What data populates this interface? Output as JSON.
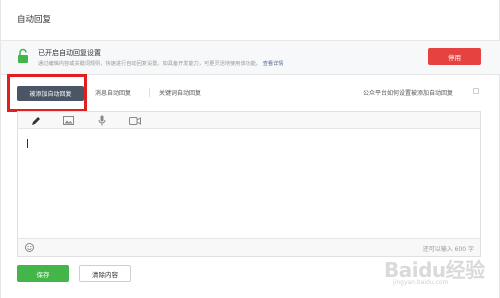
{
  "page": {
    "title": "自动回复"
  },
  "status": {
    "title": "已开启自动回复设置",
    "description": "通过编辑内容或关键词规则，快速进行自动回复设置。如具备开发能力，可更灵活地使用该功能。",
    "link": "查看详情",
    "disable_label": "停用"
  },
  "tabs": [
    {
      "label": "被添加自动回复",
      "active": true
    },
    {
      "label": "消息自动回复",
      "active": false
    },
    {
      "label": "关键词自动回复",
      "active": false
    }
  ],
  "help_link": "公众平台如何设置被添加自动回复",
  "editor": {
    "tools": [
      "pen-icon",
      "image-icon",
      "microphone-icon",
      "video-icon"
    ],
    "counter": "还可以输入 600 字"
  },
  "actions": {
    "save": "保存",
    "clear": "清除内容"
  },
  "watermark": {
    "main": "Baidu经验",
    "sub": "jingyan.baidu.com"
  },
  "colors": {
    "disable": "#e64340",
    "save": "#44b549",
    "active_tab": "#4a5566",
    "highlight": "#e02020"
  }
}
